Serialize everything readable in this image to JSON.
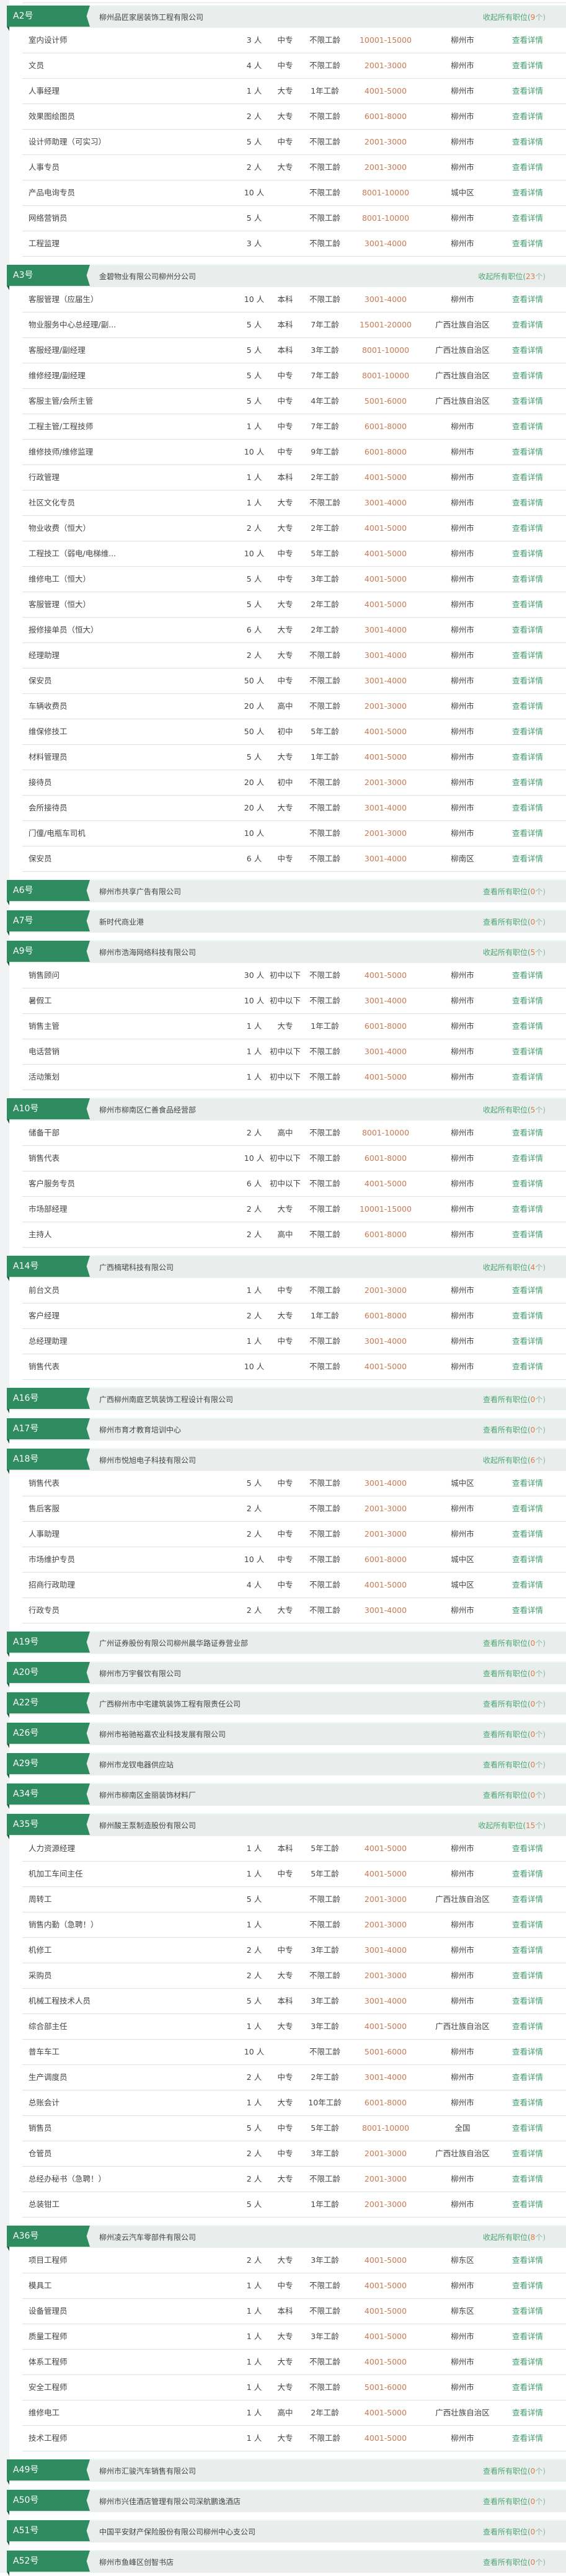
{
  "detail_label": "查看详情",
  "sections": [
    {
      "tag": "A2号",
      "company": "柳州品匠家居装饰工程有限公司",
      "toggle": "收起所有职位(",
      "count": "9",
      "suffix": "个)",
      "jobs": [
        [
          "室内设计师",
          "3 人",
          "中专",
          "不限工龄",
          "10001-15000",
          "柳州市"
        ],
        [
          "文员",
          "4 人",
          "中专",
          "不限工龄",
          "2001-3000",
          "柳州市"
        ],
        [
          "人事经理",
          "1 人",
          "大专",
          "1年工龄",
          "4001-5000",
          "柳州市"
        ],
        [
          "效果图绘图员",
          "2 人",
          "大专",
          "不限工龄",
          "6001-8000",
          "柳州市"
        ],
        [
          "设计师助理（可实习）",
          "5 人",
          "中专",
          "不限工龄",
          "2001-3000",
          "柳州市"
        ],
        [
          "人事专员",
          "2 人",
          "大专",
          "不限工龄",
          "2001-3000",
          "柳州市"
        ],
        [
          "产品电询专员",
          "10 人",
          "",
          "不限工龄",
          "8001-10000",
          "城中区"
        ],
        [
          "网络营销员",
          "5 人",
          "",
          "不限工龄",
          "8001-10000",
          "柳州市"
        ],
        [
          "工程监理",
          "3 人",
          "",
          "不限工龄",
          "3001-4000",
          "柳州市"
        ]
      ]
    },
    {
      "tag": "A3号",
      "company": "金碧物业有限公司柳州分公司",
      "toggle": "收起所有职位(",
      "count": "23",
      "suffix": "个)",
      "jobs": [
        [
          "客服管理（应届生）",
          "10 人",
          "本科",
          "不限工龄",
          "3001-4000",
          "柳州市"
        ],
        [
          "物业服务中心总经理/副...",
          "5 人",
          "本科",
          "7年工龄",
          "15001-20000",
          "广西壮族自治区"
        ],
        [
          "客服经理/副经理",
          "5 人",
          "本科",
          "3年工龄",
          "8001-10000",
          "广西壮族自治区"
        ],
        [
          "维修经理/副经理",
          "5 人",
          "中专",
          "7年工龄",
          "8001-10000",
          "广西壮族自治区"
        ],
        [
          "客服主管/会所主管",
          "5 人",
          "中专",
          "4年工龄",
          "5001-6000",
          "广西壮族自治区"
        ],
        [
          "工程主管/工程技师",
          "1 人",
          "中专",
          "7年工龄",
          "6001-8000",
          "柳州市"
        ],
        [
          "维修技师/维修监理",
          "10 人",
          "中专",
          "9年工龄",
          "6001-8000",
          "柳州市"
        ],
        [
          "行政管理",
          "1 人",
          "本科",
          "2年工龄",
          "4001-5000",
          "柳州市"
        ],
        [
          "社区文化专员",
          "1 人",
          "大专",
          "不限工龄",
          "3001-4000",
          "柳州市"
        ],
        [
          "物业收费（恒大）",
          "2 人",
          "大专",
          "2年工龄",
          "4001-5000",
          "柳州市"
        ],
        [
          "工程技工（弱电/电梯维...",
          "10 人",
          "中专",
          "5年工龄",
          "4001-5000",
          "柳州市"
        ],
        [
          "维修电工（恒大）",
          "5 人",
          "中专",
          "3年工龄",
          "4001-5000",
          "柳州市"
        ],
        [
          "客服管理（恒大）",
          "5 人",
          "大专",
          "2年工龄",
          "4001-5000",
          "柳州市"
        ],
        [
          "报修接单员（恒大）",
          "6 人",
          "大专",
          "2年工龄",
          "3001-4000",
          "柳州市"
        ],
        [
          "经理助理",
          "2 人",
          "大专",
          "不限工龄",
          "3001-4000",
          "柳州市"
        ],
        [
          "保安员",
          "50 人",
          "中专",
          "不限工龄",
          "3001-4000",
          "柳州市"
        ],
        [
          "车辆收费员",
          "20 人",
          "高中",
          "不限工龄",
          "2001-3000",
          "柳州市"
        ],
        [
          "维保修技工",
          "50 人",
          "初中",
          "5年工龄",
          "4001-5000",
          "柳州市"
        ],
        [
          "材料管理员",
          "5 人",
          "大专",
          "1年工龄",
          "4001-5000",
          "柳州市"
        ],
        [
          "接待员",
          "20 人",
          "初中",
          "不限工龄",
          "2001-3000",
          "柳州市"
        ],
        [
          "会所接待员",
          "20 人",
          "大专",
          "不限工龄",
          "3001-4000",
          "柳州市"
        ],
        [
          "门僮/电瓶车司机",
          "10 人",
          "",
          "不限工龄",
          "2001-3000",
          "柳州市"
        ],
        [
          "保安员",
          "6 人",
          "中专",
          "不限工龄",
          "3001-4000",
          "柳南区"
        ]
      ]
    },
    {
      "tag": "A6号",
      "company": "柳州市共享广告有限公司",
      "toggle": "查看所有职位(",
      "count": "0",
      "suffix": "个)",
      "jobs": []
    },
    {
      "tag": "A7号",
      "company": "新时代商业港",
      "toggle": "查看所有职位(",
      "count": "0",
      "suffix": "个)",
      "jobs": []
    },
    {
      "tag": "A9号",
      "company": "柳州市浩海网络科技有限公司",
      "toggle": "收起所有职位(",
      "count": "5",
      "suffix": "个)",
      "jobs": [
        [
          "销售顾问",
          "30 人",
          "初中以下",
          "不限工龄",
          "4001-5000",
          "柳州市"
        ],
        [
          "暑假工",
          "10 人",
          "初中以下",
          "不限工龄",
          "3001-4000",
          "柳州市"
        ],
        [
          "销售主管",
          "1 人",
          "大专",
          "1年工龄",
          "6001-8000",
          "柳州市"
        ],
        [
          "电话营销",
          "1 人",
          "初中以下",
          "不限工龄",
          "3001-4000",
          "柳州市"
        ],
        [
          "活动策划",
          "1 人",
          "初中以下",
          "不限工龄",
          "4001-5000",
          "柳州市"
        ]
      ]
    },
    {
      "tag": "A10号",
      "company": "柳州市柳南区仁善食品经营部",
      "toggle": "收起所有职位(",
      "count": "5",
      "suffix": "个)",
      "jobs": [
        [
          "储备干部",
          "2 人",
          "高中",
          "不限工龄",
          "8001-10000",
          "柳州市"
        ],
        [
          "销售代表",
          "10 人",
          "初中以下",
          "不限工龄",
          "6001-8000",
          "柳州市"
        ],
        [
          "客户服务专员",
          "6 人",
          "初中以下",
          "不限工龄",
          "4001-5000",
          "柳州市"
        ],
        [
          "市场部经理",
          "2 人",
          "大专",
          "不限工龄",
          "10001-15000",
          "柳州市"
        ],
        [
          "主持人",
          "2 人",
          "高中",
          "不限工龄",
          "6001-8000",
          "柳州市"
        ]
      ]
    },
    {
      "tag": "A14号",
      "company": "广西楠珺科技有限公司",
      "toggle": "收起所有职位(",
      "count": "4",
      "suffix": "个)",
      "jobs": [
        [
          "前台文员",
          "1 人",
          "中专",
          "不限工龄",
          "2001-3000",
          "柳州市"
        ],
        [
          "客户经理",
          "2 人",
          "大专",
          "1年工龄",
          "6001-8000",
          "柳州市"
        ],
        [
          "总经理助理",
          "1 人",
          "中专",
          "不限工龄",
          "3001-4000",
          "柳州市"
        ],
        [
          "销售代表",
          "10 人",
          "",
          "不限工龄",
          "4001-5000",
          "柳州市"
        ]
      ]
    },
    {
      "tag": "A16号",
      "company": "广西柳州南庭艺筑装饰工程设计有限公司",
      "toggle": "查看所有职位(",
      "count": "0",
      "suffix": "个)",
      "jobs": []
    },
    {
      "tag": "A17号",
      "company": "柳州市育才教育培训中心",
      "toggle": "查看所有职位(",
      "count": "0",
      "suffix": "个)",
      "jobs": []
    },
    {
      "tag": "A18号",
      "company": "柳州市悦旭电子科技有限公司",
      "toggle": "收起所有职位(",
      "count": "6",
      "suffix": "个)",
      "jobs": [
        [
          "销售代表",
          "5 人",
          "中专",
          "不限工龄",
          "3001-4000",
          "城中区"
        ],
        [
          "售后客服",
          "2 人",
          "",
          "不限工龄",
          "2001-3000",
          "柳州市"
        ],
        [
          "人事助理",
          "2 人",
          "中专",
          "不限工龄",
          "2001-3000",
          "柳州市"
        ],
        [
          "市场维护专员",
          "10 人",
          "中专",
          "不限工龄",
          "6001-8000",
          "城中区"
        ],
        [
          "招商行政助理",
          "4 人",
          "中专",
          "不限工龄",
          "4001-5000",
          "城中区"
        ],
        [
          "行政专员",
          "2 人",
          "大专",
          "不限工龄",
          "3001-4000",
          "柳州市"
        ]
      ]
    },
    {
      "tag": "A19号",
      "company": "广州证券股份有限公司柳州晨华路证券营业部",
      "toggle": "查看所有职位(",
      "count": "0",
      "suffix": "个)",
      "jobs": []
    },
    {
      "tag": "A20号",
      "company": "柳州市万宇餐饮有限公司",
      "toggle": "查看所有职位(",
      "count": "0",
      "suffix": "个)",
      "jobs": []
    },
    {
      "tag": "A22号",
      "company": "广西柳州市中宅建筑装饰工程有限责任公司",
      "toggle": "查看所有职位(",
      "count": "0",
      "suffix": "个)",
      "jobs": []
    },
    {
      "tag": "A26号",
      "company": "柳州市裕驰裕嘉农业科技发展有限公司",
      "toggle": "查看所有职位(",
      "count": "0",
      "suffix": "个)",
      "jobs": []
    },
    {
      "tag": "A29号",
      "company": "柳州市龙钗电器供应站",
      "toggle": "查看所有职位(",
      "count": "0",
      "suffix": "个)",
      "jobs": []
    },
    {
      "tag": "A34号",
      "company": "柳州市柳南区金丽装饰材料厂",
      "toggle": "查看所有职位(",
      "count": "0",
      "suffix": "个)",
      "jobs": []
    },
    {
      "tag": "A35号",
      "company": "柳州酸王泵制造股份有限公司",
      "toggle": "收起所有职位(",
      "count": "15",
      "suffix": "个)",
      "jobs": [
        [
          "人力资源经理",
          "1 人",
          "本科",
          "5年工龄",
          "4001-5000",
          "柳州市"
        ],
        [
          "机加工车间主任",
          "1 人",
          "中专",
          "5年工龄",
          "4001-5000",
          "柳州市"
        ],
        [
          "周转工",
          "5 人",
          "",
          "不限工龄",
          "2001-3000",
          "广西壮族自治区"
        ],
        [
          "销售内勤（急聘！）",
          "1 人",
          "",
          "不限工龄",
          "2001-3000",
          "柳州市"
        ],
        [
          "机修工",
          "2 人",
          "中专",
          "3年工龄",
          "3001-4000",
          "柳州市"
        ],
        [
          "采购员",
          "2 人",
          "大专",
          "不限工龄",
          "2001-3000",
          "柳州市"
        ],
        [
          "机械工程技术人员",
          "5 人",
          "本科",
          "3年工龄",
          "3001-4000",
          "柳州市"
        ],
        [
          "综合部主任",
          "1 人",
          "大专",
          "3年工龄",
          "4001-5000",
          "广西壮族自治区"
        ],
        [
          "普车车工",
          "10 人",
          "",
          "不限工龄",
          "5001-6000",
          "柳州市"
        ],
        [
          "生产调度员",
          "2 人",
          "中专",
          "2年工龄",
          "3001-4000",
          "柳州市"
        ],
        [
          "总账会计",
          "1 人",
          "大专",
          "10年工龄",
          "6001-8000",
          "柳州市"
        ],
        [
          "销售员",
          "5 人",
          "中专",
          "5年工龄",
          "8001-10000",
          "全国"
        ],
        [
          "仓管员",
          "2 人",
          "中专",
          "3年工龄",
          "2001-3000",
          "广西壮族自治区"
        ],
        [
          "总经办秘书（急聘！）",
          "2 人",
          "大专",
          "不限工龄",
          "2001-3000",
          "柳州市"
        ],
        [
          "总装钳工",
          "5 人",
          "",
          "1年工龄",
          "2001-3000",
          "柳州市"
        ]
      ]
    },
    {
      "tag": "A36号",
      "company": "柳州凌云汽车零部件有限公司",
      "toggle": "收起所有职位(",
      "count": "8",
      "suffix": "个)",
      "jobs": [
        [
          "项目工程师",
          "2 人",
          "大专",
          "3年工龄",
          "4001-5000",
          "柳东区"
        ],
        [
          "模具工",
          "1 人",
          "中专",
          "不限工龄",
          "4001-5000",
          "柳州市"
        ],
        [
          "设备管理员",
          "1 人",
          "本科",
          "不限工龄",
          "4001-5000",
          "柳东区"
        ],
        [
          "质量工程师",
          "1 人",
          "大专",
          "3年工龄",
          "4001-5000",
          "柳州市"
        ],
        [
          "体系工程师",
          "1 人",
          "大专",
          "不限工龄",
          "4001-5000",
          "柳州市"
        ],
        [
          "安全工程师",
          "1 人",
          "大专",
          "不限工龄",
          "5001-6000",
          "柳州市"
        ],
        [
          "维修电工",
          "1 人",
          "高中",
          "2年工龄",
          "4001-5000",
          "广西壮族自治区"
        ],
        [
          "技术工程师",
          "1 人",
          "大专",
          "不限工龄",
          "4001-5000",
          "柳州市"
        ]
      ]
    },
    {
      "tag": "A49号",
      "company": "柳州市汇骏汽车销售有限公司",
      "toggle": "查看所有职位(",
      "count": "0",
      "suffix": "个)",
      "jobs": []
    },
    {
      "tag": "A50号",
      "company": "柳州市兴佳酒店管理有限公司深航鹏逸酒店",
      "toggle": "查看所有职位(",
      "count": "0",
      "suffix": "个)",
      "jobs": []
    },
    {
      "tag": "A51号",
      "company": "中国平安财产保险股份有限公司柳州中心支公司",
      "toggle": "查看所有职位(",
      "count": "0",
      "suffix": "个)",
      "jobs": []
    },
    {
      "tag": "A52号",
      "company": "柳州市鱼峰区创智书店",
      "toggle": "查看所有职位(",
      "count": "0",
      "suffix": "个)",
      "jobs": []
    }
  ]
}
